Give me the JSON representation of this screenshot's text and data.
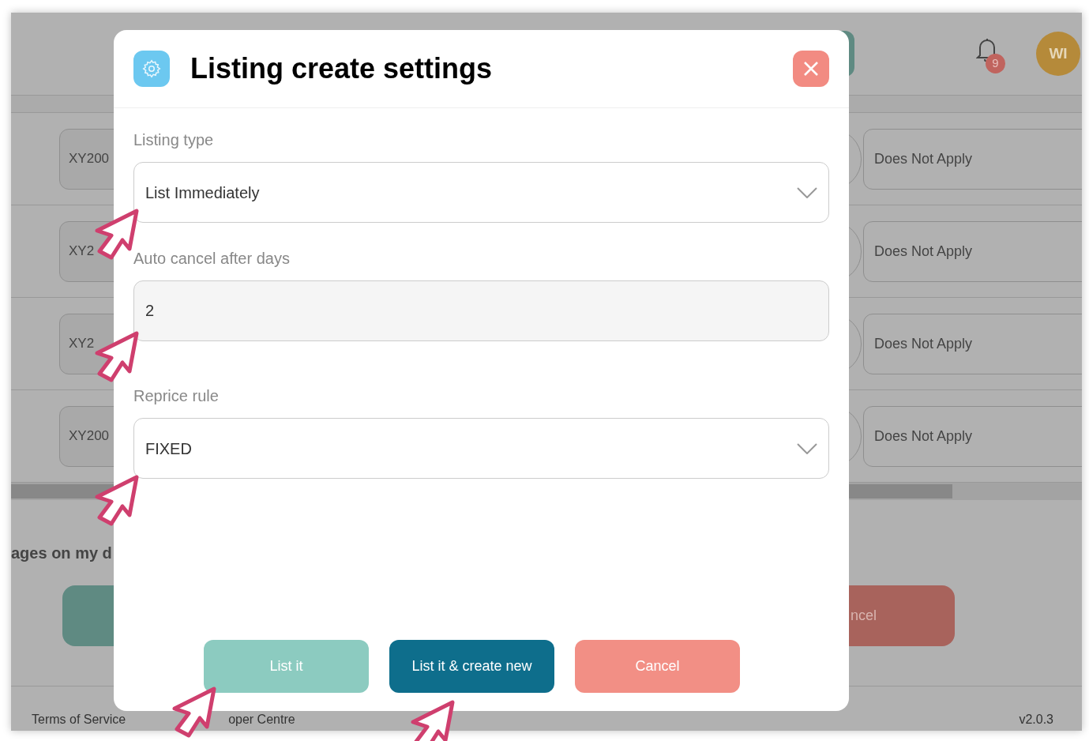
{
  "header": {
    "notification_count": "9",
    "avatar_initials": "WI"
  },
  "rows": [
    {
      "code": "XY200",
      "value": "Does Not Apply"
    },
    {
      "code": "XY2",
      "value": "Does Not Apply"
    },
    {
      "code": "XY2",
      "value": "Does Not Apply"
    },
    {
      "code": "XY200",
      "value": "Does Not Apply"
    }
  ],
  "section_heading": "ages on my d",
  "background_button": "ncel",
  "footer": {
    "links": [
      "Terms of Service",
      "oper Centre"
    ],
    "version": "v2.0.3"
  },
  "dialog": {
    "title": "Listing create settings",
    "fields": [
      {
        "kind": "select",
        "label": "Listing type",
        "value": "List Immediately"
      },
      {
        "kind": "input",
        "label": "Auto cancel after days",
        "value": "2"
      },
      {
        "kind": "select",
        "label": "Reprice rule",
        "value": "FIXED"
      }
    ],
    "buttons": [
      {
        "kind": "secondary",
        "label": "List it"
      },
      {
        "kind": "primary",
        "label": "List it & create new"
      },
      {
        "kind": "danger",
        "label": "Cancel"
      }
    ]
  }
}
